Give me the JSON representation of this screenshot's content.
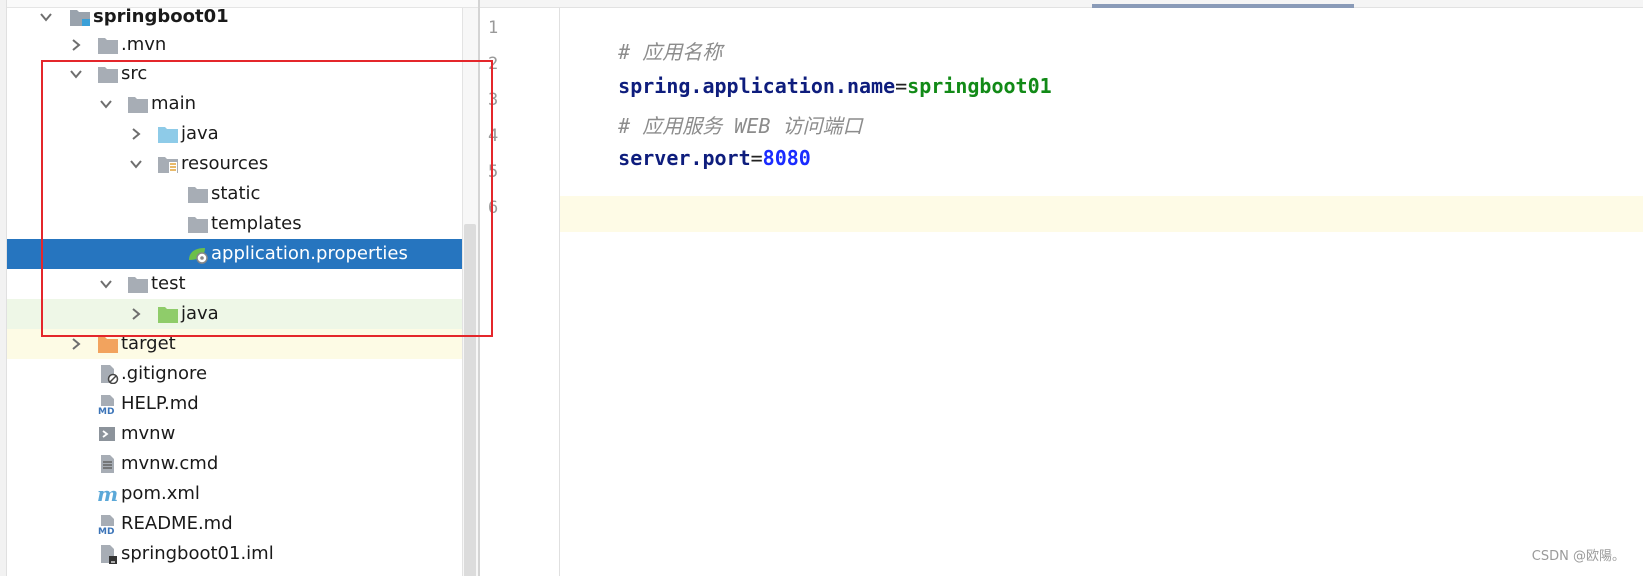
{
  "project_tree": {
    "root": "springboot01",
    "items": {
      "mvn": ".mvn",
      "src": "src",
      "main": "main",
      "main_java": "java",
      "resources": "resources",
      "static": "static",
      "templates": "templates",
      "application_properties": "application.properties",
      "test": "test",
      "test_java": "java",
      "target": "target",
      "gitignore": ".gitignore",
      "help_md": "HELP.md",
      "mvnw": "mvnw",
      "mvnw_cmd": "mvnw.cmd",
      "pom_xml": "pom.xml",
      "readme_md": "README.md",
      "iml": "springboot01.iml"
    },
    "icon_texts": {
      "md": "MD",
      "maven": "m"
    }
  },
  "editor": {
    "line_numbers": [
      "1",
      "2",
      "3",
      "4",
      "5",
      "6"
    ],
    "lines": {
      "l1_comment": "# 应用名称",
      "l2_key": "spring.application.name",
      "l2_eq": "=",
      "l2_value": "springboot01",
      "l3_comment": "# 应用服务 WEB 访问端口",
      "l4_key": "server.port",
      "l4_eq": "=",
      "l4_value": "8080"
    }
  },
  "watermark": "CSDN @欧陽。",
  "colors": {
    "selection": "#2675bf",
    "annotation_box": "#e4262b",
    "comment": "#8c8c8c",
    "property_key": "#0e1d7d",
    "property_value": "#128a17",
    "number_value": "#1a2bff"
  }
}
